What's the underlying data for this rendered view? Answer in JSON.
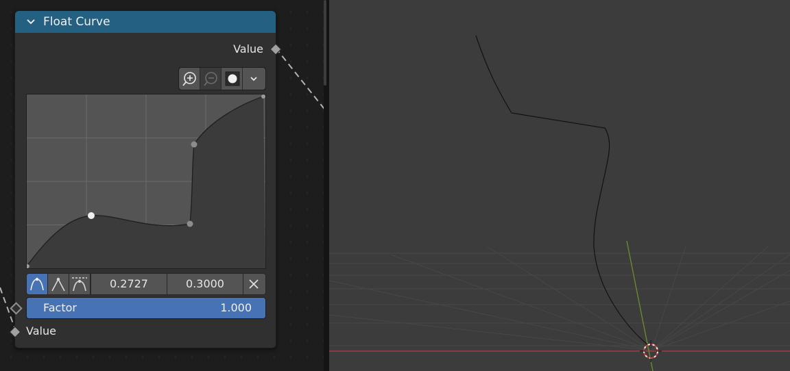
{
  "node": {
    "title": "Float Curve",
    "output_label": "Value",
    "input_label": "Value",
    "factor_label": "Factor",
    "factor_value": "1.000",
    "selected_point_x": "0.2727",
    "selected_point_y": "0.3000"
  },
  "toolbar": {
    "zoom_in_icon": "zoom-in-icon",
    "zoom_out_icon": "zoom-out-icon",
    "reset_view_icon": "reset-view-icon",
    "specials_icon": "chevron-down-icon"
  },
  "handle_types": [
    "auto",
    "vector",
    "auto-clamped"
  ],
  "curve": {
    "points": [
      {
        "x": 0.0,
        "y": 0.0
      },
      {
        "x": 0.2727,
        "y": 0.3,
        "selected": true
      },
      {
        "x": 0.69,
        "y": 0.25
      },
      {
        "x": 0.7,
        "y": 0.71
      },
      {
        "x": 1.0,
        "y": 1.0
      }
    ]
  },
  "colors": {
    "header": "#236081",
    "accent": "#4772b3",
    "node_body": "#303030",
    "curve_bg": "#545454",
    "viewport_bg": "#3c3c3c",
    "x_axis": "#a13b44",
    "y_axis": "#6a8a2e"
  }
}
